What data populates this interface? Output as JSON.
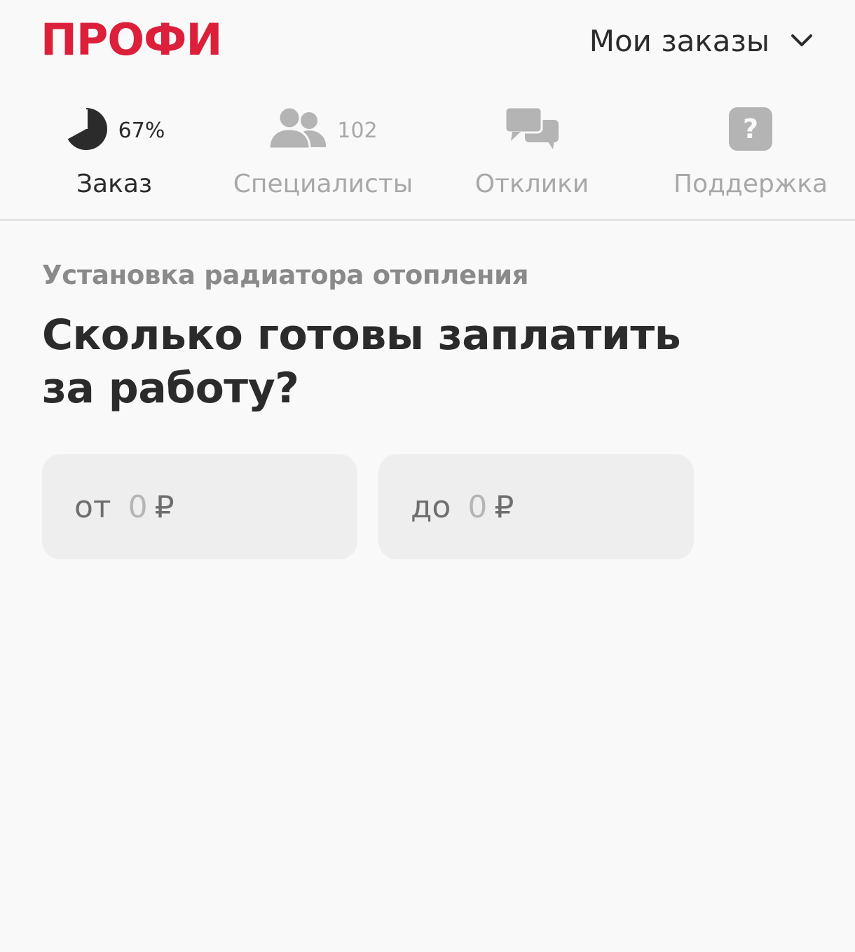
{
  "header": {
    "logo": "ПРОФИ",
    "orders_menu": "Мои заказы",
    "brand_color": "#dc1f3b"
  },
  "tabs": [
    {
      "label": "Заказ",
      "count": "67%",
      "icon": "pie-progress-icon",
      "active": true,
      "progress_percent": 67
    },
    {
      "label": "Специалисты",
      "count": "102",
      "icon": "users-icon",
      "active": false
    },
    {
      "label": "Отклики",
      "icon": "chat-bubbles-icon",
      "active": false
    },
    {
      "label": "Поддержка",
      "icon": "help-question-icon",
      "active": false
    }
  ],
  "page": {
    "subtitle": "Установка радиатора отопления",
    "question": "Сколько готовы заплатить за работу?"
  },
  "price": {
    "from": {
      "prefix": "от",
      "value": "0",
      "currency": "₽"
    },
    "to": {
      "prefix": "до",
      "value": "0",
      "currency": "₽"
    }
  }
}
